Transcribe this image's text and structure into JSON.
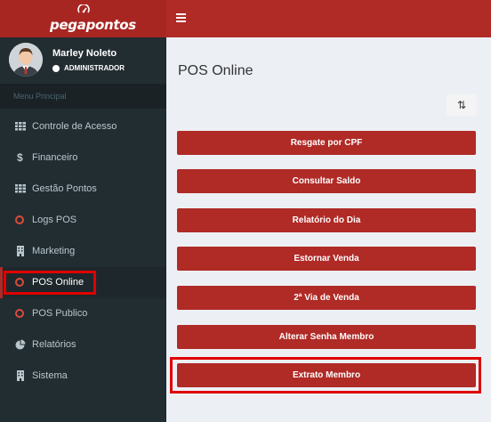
{
  "header": {
    "logo_text": "pegapontos"
  },
  "user": {
    "name": "Marley Noleto",
    "role": "ADMINISTRADOR"
  },
  "sidebar": {
    "menu_header": "Menu Principal",
    "items": [
      {
        "label": "Controle de Acesso",
        "icon": "grid-icon"
      },
      {
        "label": "Financeiro",
        "icon": "dollar-icon"
      },
      {
        "label": "Gestão Pontos",
        "icon": "grid-icon"
      },
      {
        "label": "Logs POS",
        "icon": "circle-icon"
      },
      {
        "label": "Marketing",
        "icon": "building-icon"
      },
      {
        "label": "POS Online",
        "icon": "circle-icon"
      },
      {
        "label": "POS Publico",
        "icon": "circle-icon"
      },
      {
        "label": "Relatórios",
        "icon": "pie-chart-icon"
      },
      {
        "label": "Sistema",
        "icon": "building-icon"
      }
    ]
  },
  "main": {
    "title": "POS Online",
    "sort_label": "⇅",
    "buttons": [
      "Resgate por CPF",
      "Consultar Saldo",
      "Relatório do Dia",
      "Estornar Venda",
      "2ª Via de Venda",
      "Alterar Senha Membro",
      "Extrato Membro"
    ]
  },
  "colors": {
    "brand": "#b02a26",
    "sidebar_bg": "#222d32",
    "highlight": "#e00000"
  }
}
